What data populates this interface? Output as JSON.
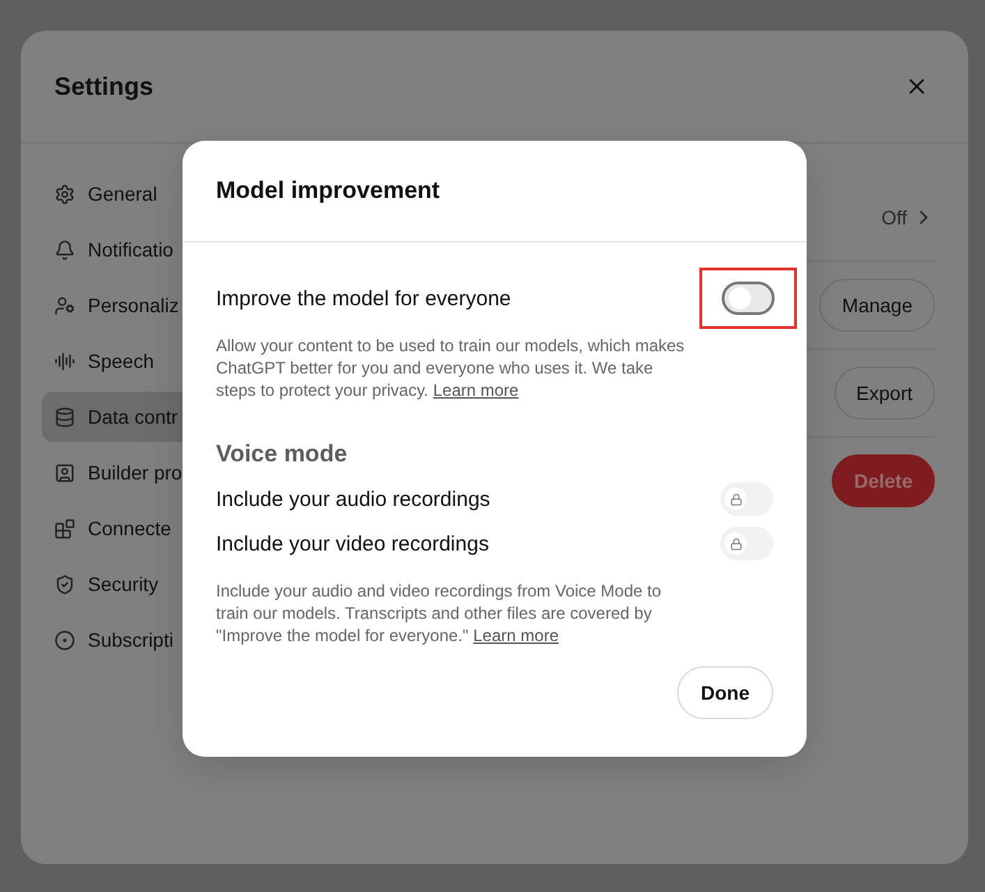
{
  "settings": {
    "title": "Settings",
    "sidebar": [
      {
        "label": "General",
        "selected": false
      },
      {
        "label": "Notificatio",
        "selected": false
      },
      {
        "label": "Personaliz",
        "selected": false
      },
      {
        "label": "Speech",
        "selected": false
      },
      {
        "label": "Data contr",
        "selected": true
      },
      {
        "label": "Builder pro",
        "selected": false
      },
      {
        "label": "Connecte",
        "selected": false
      },
      {
        "label": "Security",
        "selected": false
      },
      {
        "label": "Subscripti",
        "selected": false
      }
    ],
    "rows": [
      {
        "kind": "link",
        "value": "Off"
      },
      {
        "kind": "button",
        "value": "Manage"
      },
      {
        "kind": "button",
        "value": "Export"
      },
      {
        "kind": "danger",
        "value": "Delete"
      }
    ]
  },
  "dialog": {
    "title": "Model improvement",
    "main_setting": {
      "label": "Improve the model for everyone",
      "on": false,
      "highlighted": true,
      "description": "Allow your content to be used to train our models, which makes ChatGPT better for you and everyone who uses it. We take steps to protect your privacy.",
      "link": "Learn more"
    },
    "section": {
      "title": "Voice mode",
      "settings": [
        {
          "label": "Include your audio recordings",
          "on": false,
          "locked": true
        },
        {
          "label": "Include your video recordings",
          "on": false,
          "locked": true
        }
      ],
      "description": "Include your audio and video recordings from Voice Mode to train our models. Transcripts and other files are covered by \"Improve the model for everyone.\"",
      "link": "Learn more"
    },
    "button": "Done"
  }
}
